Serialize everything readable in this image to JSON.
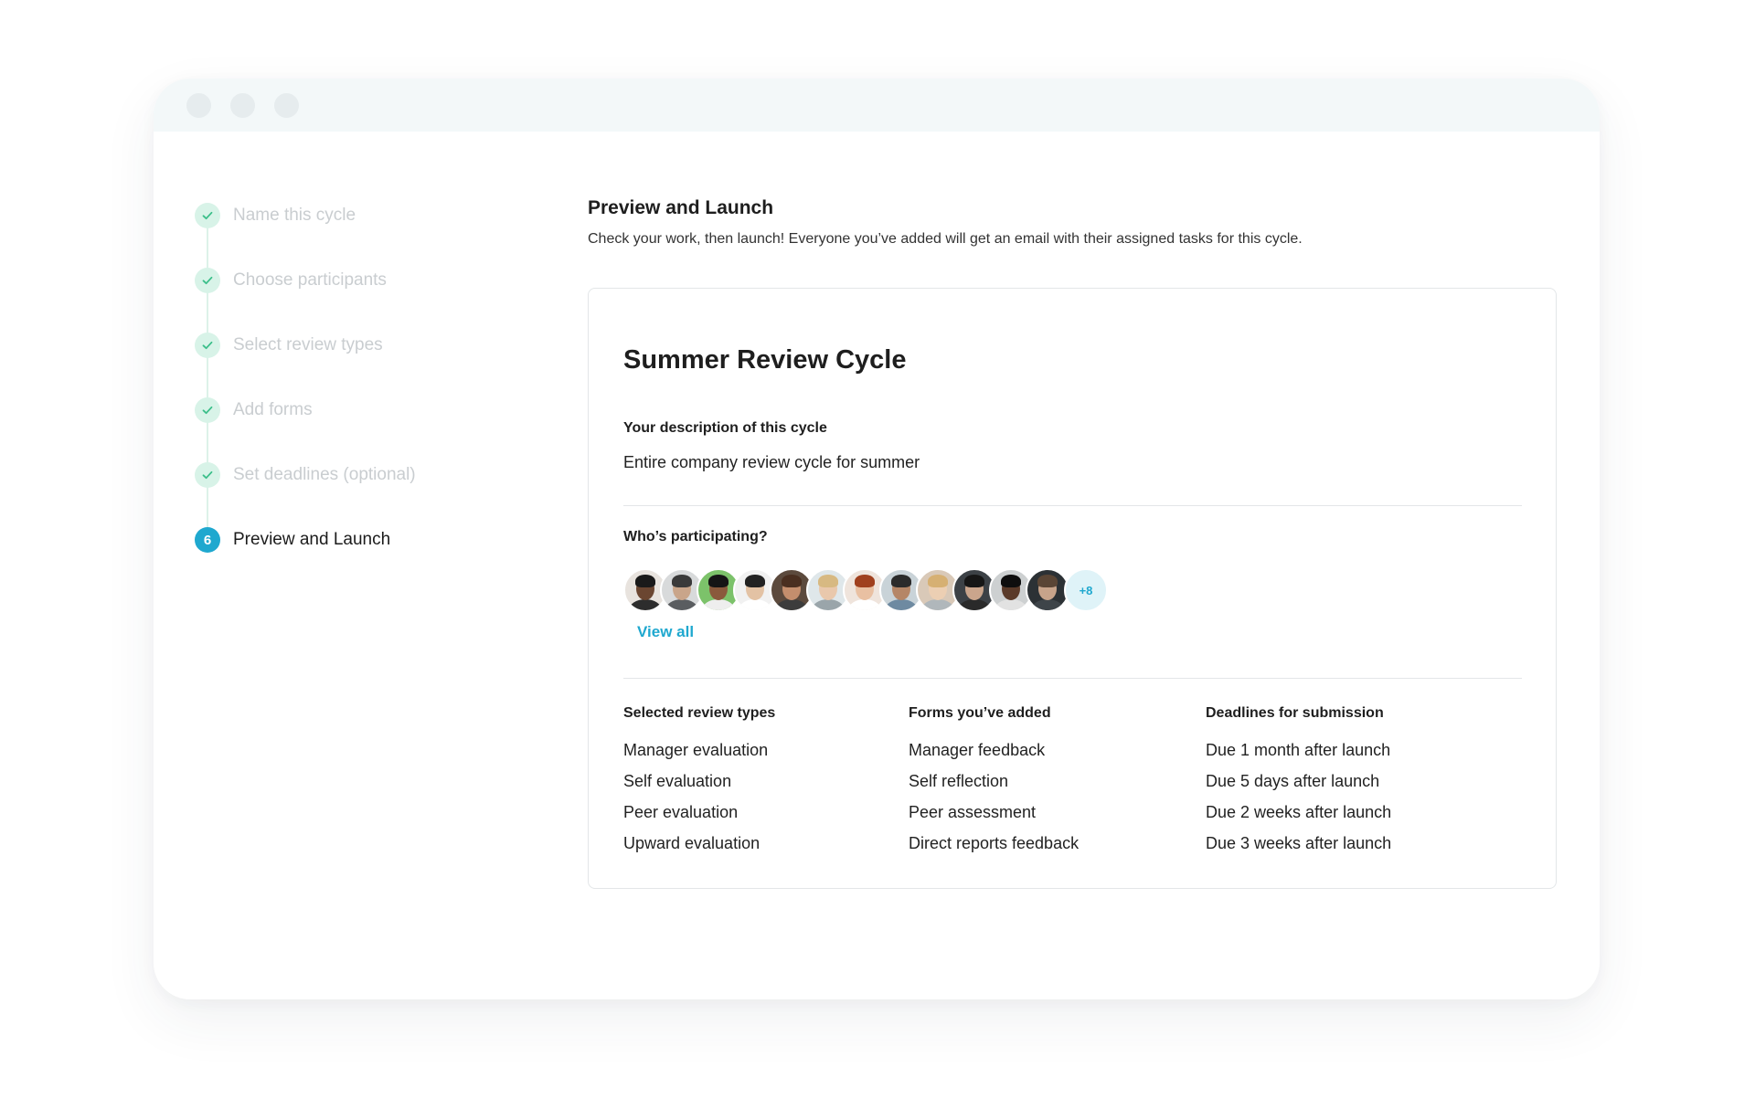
{
  "stepper": {
    "steps": [
      {
        "label": "Name this cycle",
        "state": "complete"
      },
      {
        "label": "Choose participants",
        "state": "complete"
      },
      {
        "label": "Select review types",
        "state": "complete"
      },
      {
        "label": "Add forms",
        "state": "complete"
      },
      {
        "label": "Set deadlines (optional)",
        "state": "complete"
      },
      {
        "label": "Preview and Launch",
        "state": "active",
        "number": "6"
      }
    ]
  },
  "main": {
    "heading": "Preview and Launch",
    "description": "Check your work, then launch! Everyone you’ve added will get an email with their assigned tasks for this cycle."
  },
  "card": {
    "title": "Summer Review Cycle",
    "description_label": "Your description of this cycle",
    "description_value": "Entire company review cycle for summer",
    "participants_label": "Who’s participating?",
    "participants_more": "+8",
    "view_all": "View all",
    "avatars": [
      {
        "skin": "#6b4631",
        "bg": "#e8e3de",
        "shirt": "#2d2d2d",
        "hair": "#1a1a1a"
      },
      {
        "skin": "#c9a58a",
        "bg": "#d8dadb",
        "shirt": "#5a5d60",
        "hair": "#3a3a3a"
      },
      {
        "skin": "#8a5a3c",
        "bg": "#7cc26a",
        "shirt": "#eeeeee",
        "hair": "#151515"
      },
      {
        "skin": "#e3c2a4",
        "bg": "#f1f1f1",
        "shirt": "#ffffff",
        "hair": "#222222"
      },
      {
        "skin": "#c48e6d",
        "bg": "#5c4a3d",
        "shirt": "#3c3c3c",
        "hair": "#4a2f20"
      },
      {
        "skin": "#e9c8ac",
        "bg": "#dfe7ea",
        "shirt": "#9aa5aa",
        "hair": "#d7b982"
      },
      {
        "skin": "#e9c0a2",
        "bg": "#efe4dc",
        "shirt": "#ffffff",
        "hair": "#a0401e"
      },
      {
        "skin": "#b58667",
        "bg": "#c9d3d8",
        "shirt": "#6e8aa1",
        "hair": "#2b2b2b"
      },
      {
        "skin": "#eccfb3",
        "bg": "#d9c9b8",
        "shirt": "#b0b7bb",
        "hair": "#d6b073"
      },
      {
        "skin": "#caa58c",
        "bg": "#3c4146",
        "shirt": "#2a2a2a",
        "hair": "#161616"
      },
      {
        "skin": "#5a3a29",
        "bg": "#cdd0d1",
        "shirt": "#e2e2e2",
        "hair": "#0e0e0e"
      },
      {
        "skin": "#c7a38a",
        "bg": "#2c3135",
        "shirt": "#3e4449",
        "hair": "#5a4535"
      }
    ],
    "columns": [
      {
        "header": "Selected review types",
        "items": [
          "Manager evaluation",
          "Self evaluation",
          "Peer evaluation",
          "Upward evaluation"
        ]
      },
      {
        "header": "Forms you’ve added",
        "items": [
          "Manager feedback",
          "Self reflection",
          "Peer assessment",
          "Direct reports feedback"
        ]
      },
      {
        "header": "Deadlines for submission",
        "items": [
          "Due 1 month after launch",
          "Due 5 days after launch",
          "Due 2 weeks after launch",
          "Due 3 weeks after launch"
        ]
      }
    ]
  },
  "colors": {
    "accent": "#1fa8cf",
    "check_bg": "#d8f3e8",
    "check_mark": "#3bbf8a",
    "completed_text": "#c9cdd0"
  }
}
